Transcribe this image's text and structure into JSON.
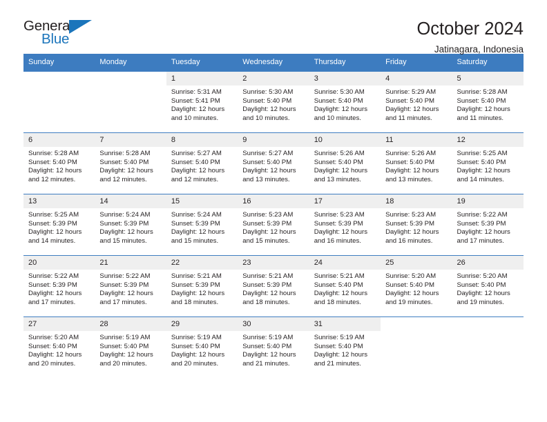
{
  "brand": {
    "name_top": "General",
    "name_bottom": "Blue",
    "accent_color": "#1b75bb"
  },
  "header": {
    "title": "October 2024",
    "subtitle": "Jatinagara, Indonesia"
  },
  "theme": {
    "header_row_bg": "#3d7cc0",
    "day_number_bg": "#efefef",
    "text_color": "#231f20"
  },
  "calendar": {
    "weekday_headers": [
      "Sunday",
      "Monday",
      "Tuesday",
      "Wednesday",
      "Thursday",
      "Friday",
      "Saturday"
    ],
    "weeks": [
      [
        {
          "day": "",
          "empty": true
        },
        {
          "day": "",
          "empty": true
        },
        {
          "day": "1",
          "sunrise": "Sunrise: 5:31 AM",
          "sunset": "Sunset: 5:41 PM",
          "daylight": "Daylight: 12 hours and 10 minutes."
        },
        {
          "day": "2",
          "sunrise": "Sunrise: 5:30 AM",
          "sunset": "Sunset: 5:40 PM",
          "daylight": "Daylight: 12 hours and 10 minutes."
        },
        {
          "day": "3",
          "sunrise": "Sunrise: 5:30 AM",
          "sunset": "Sunset: 5:40 PM",
          "daylight": "Daylight: 12 hours and 10 minutes."
        },
        {
          "day": "4",
          "sunrise": "Sunrise: 5:29 AM",
          "sunset": "Sunset: 5:40 PM",
          "daylight": "Daylight: 12 hours and 11 minutes."
        },
        {
          "day": "5",
          "sunrise": "Sunrise: 5:28 AM",
          "sunset": "Sunset: 5:40 PM",
          "daylight": "Daylight: 12 hours and 11 minutes."
        }
      ],
      [
        {
          "day": "6",
          "sunrise": "Sunrise: 5:28 AM",
          "sunset": "Sunset: 5:40 PM",
          "daylight": "Daylight: 12 hours and 12 minutes."
        },
        {
          "day": "7",
          "sunrise": "Sunrise: 5:28 AM",
          "sunset": "Sunset: 5:40 PM",
          "daylight": "Daylight: 12 hours and 12 minutes."
        },
        {
          "day": "8",
          "sunrise": "Sunrise: 5:27 AM",
          "sunset": "Sunset: 5:40 PM",
          "daylight": "Daylight: 12 hours and 12 minutes."
        },
        {
          "day": "9",
          "sunrise": "Sunrise: 5:27 AM",
          "sunset": "Sunset: 5:40 PM",
          "daylight": "Daylight: 12 hours and 13 minutes."
        },
        {
          "day": "10",
          "sunrise": "Sunrise: 5:26 AM",
          "sunset": "Sunset: 5:40 PM",
          "daylight": "Daylight: 12 hours and 13 minutes."
        },
        {
          "day": "11",
          "sunrise": "Sunrise: 5:26 AM",
          "sunset": "Sunset: 5:40 PM",
          "daylight": "Daylight: 12 hours and 13 minutes."
        },
        {
          "day": "12",
          "sunrise": "Sunrise: 5:25 AM",
          "sunset": "Sunset: 5:40 PM",
          "daylight": "Daylight: 12 hours and 14 minutes."
        }
      ],
      [
        {
          "day": "13",
          "sunrise": "Sunrise: 5:25 AM",
          "sunset": "Sunset: 5:39 PM",
          "daylight": "Daylight: 12 hours and 14 minutes."
        },
        {
          "day": "14",
          "sunrise": "Sunrise: 5:24 AM",
          "sunset": "Sunset: 5:39 PM",
          "daylight": "Daylight: 12 hours and 15 minutes."
        },
        {
          "day": "15",
          "sunrise": "Sunrise: 5:24 AM",
          "sunset": "Sunset: 5:39 PM",
          "daylight": "Daylight: 12 hours and 15 minutes."
        },
        {
          "day": "16",
          "sunrise": "Sunrise: 5:23 AM",
          "sunset": "Sunset: 5:39 PM",
          "daylight": "Daylight: 12 hours and 15 minutes."
        },
        {
          "day": "17",
          "sunrise": "Sunrise: 5:23 AM",
          "sunset": "Sunset: 5:39 PM",
          "daylight": "Daylight: 12 hours and 16 minutes."
        },
        {
          "day": "18",
          "sunrise": "Sunrise: 5:23 AM",
          "sunset": "Sunset: 5:39 PM",
          "daylight": "Daylight: 12 hours and 16 minutes."
        },
        {
          "day": "19",
          "sunrise": "Sunrise: 5:22 AM",
          "sunset": "Sunset: 5:39 PM",
          "daylight": "Daylight: 12 hours and 17 minutes."
        }
      ],
      [
        {
          "day": "20",
          "sunrise": "Sunrise: 5:22 AM",
          "sunset": "Sunset: 5:39 PM",
          "daylight": "Daylight: 12 hours and 17 minutes."
        },
        {
          "day": "21",
          "sunrise": "Sunrise: 5:22 AM",
          "sunset": "Sunset: 5:39 PM",
          "daylight": "Daylight: 12 hours and 17 minutes."
        },
        {
          "day": "22",
          "sunrise": "Sunrise: 5:21 AM",
          "sunset": "Sunset: 5:39 PM",
          "daylight": "Daylight: 12 hours and 18 minutes."
        },
        {
          "day": "23",
          "sunrise": "Sunrise: 5:21 AM",
          "sunset": "Sunset: 5:39 PM",
          "daylight": "Daylight: 12 hours and 18 minutes."
        },
        {
          "day": "24",
          "sunrise": "Sunrise: 5:21 AM",
          "sunset": "Sunset: 5:40 PM",
          "daylight": "Daylight: 12 hours and 18 minutes."
        },
        {
          "day": "25",
          "sunrise": "Sunrise: 5:20 AM",
          "sunset": "Sunset: 5:40 PM",
          "daylight": "Daylight: 12 hours and 19 minutes."
        },
        {
          "day": "26",
          "sunrise": "Sunrise: 5:20 AM",
          "sunset": "Sunset: 5:40 PM",
          "daylight": "Daylight: 12 hours and 19 minutes."
        }
      ],
      [
        {
          "day": "27",
          "sunrise": "Sunrise: 5:20 AM",
          "sunset": "Sunset: 5:40 PM",
          "daylight": "Daylight: 12 hours and 20 minutes."
        },
        {
          "day": "28",
          "sunrise": "Sunrise: 5:19 AM",
          "sunset": "Sunset: 5:40 PM",
          "daylight": "Daylight: 12 hours and 20 minutes."
        },
        {
          "day": "29",
          "sunrise": "Sunrise: 5:19 AM",
          "sunset": "Sunset: 5:40 PM",
          "daylight": "Daylight: 12 hours and 20 minutes."
        },
        {
          "day": "30",
          "sunrise": "Sunrise: 5:19 AM",
          "sunset": "Sunset: 5:40 PM",
          "daylight": "Daylight: 12 hours and 21 minutes."
        },
        {
          "day": "31",
          "sunrise": "Sunrise: 5:19 AM",
          "sunset": "Sunset: 5:40 PM",
          "daylight": "Daylight: 12 hours and 21 minutes."
        },
        {
          "day": "",
          "empty": true
        },
        {
          "day": "",
          "empty": true
        }
      ]
    ]
  }
}
